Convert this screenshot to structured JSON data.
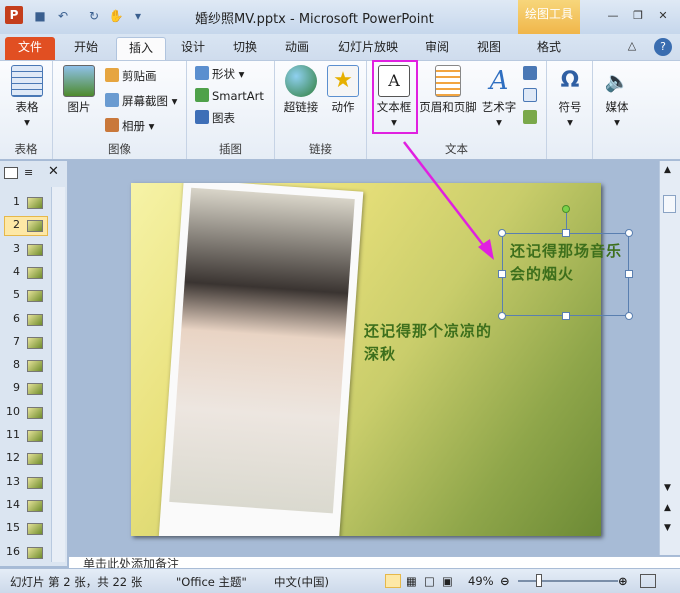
{
  "window": {
    "title": "婚纱照MV.pptx - Microsoft PowerPoint",
    "drawing_tools": "绘图工具",
    "logo": "P"
  },
  "tabs": [
    "文件",
    "开始",
    "插入",
    "设计",
    "切换",
    "动画",
    "幻灯片放映",
    "审阅",
    "视图",
    "格式"
  ],
  "ribbon": {
    "groups": {
      "table": {
        "label": "表格",
        "button": "表格"
      },
      "image": {
        "label": "图像",
        "picture": "图片",
        "clipart": "剪贴画",
        "screenshot": "屏幕截图",
        "album": "相册"
      },
      "illustration": {
        "label": "插图",
        "shapes": "形状",
        "smartart": "SmartArt",
        "chart": "图表"
      },
      "links": {
        "label": "链接",
        "hyperlink": "超链接",
        "action": "动作"
      },
      "text": {
        "label": "文本",
        "textbox": "文本框",
        "header_footer": "页眉和页脚",
        "wordart": "艺术字"
      },
      "symbols": {
        "button": "符号"
      },
      "media": {
        "button": "媒体"
      }
    }
  },
  "slides_panel": {
    "numbers": [
      "1",
      "2",
      "3",
      "4",
      "5",
      "6",
      "7",
      "8",
      "9",
      "10",
      "11",
      "12",
      "13",
      "14",
      "15",
      "16"
    ],
    "selected": "2"
  },
  "slide": {
    "text1": "还记得那场音乐会的烟火",
    "text2": "还记得那个凉凉的深秋"
  },
  "notes_placeholder": "单击此处添加备注",
  "status": {
    "slide_info": "幻灯片 第 2 张，共 22 张",
    "theme": "\"Office 主题\"",
    "language": "中文(中国)",
    "zoom": "49%"
  },
  "colors": {
    "file_tab": "#e14f22",
    "highlight": "#e020e0",
    "slide_text": "#3d6f1c",
    "drawing_tools": "#f0b64a"
  }
}
